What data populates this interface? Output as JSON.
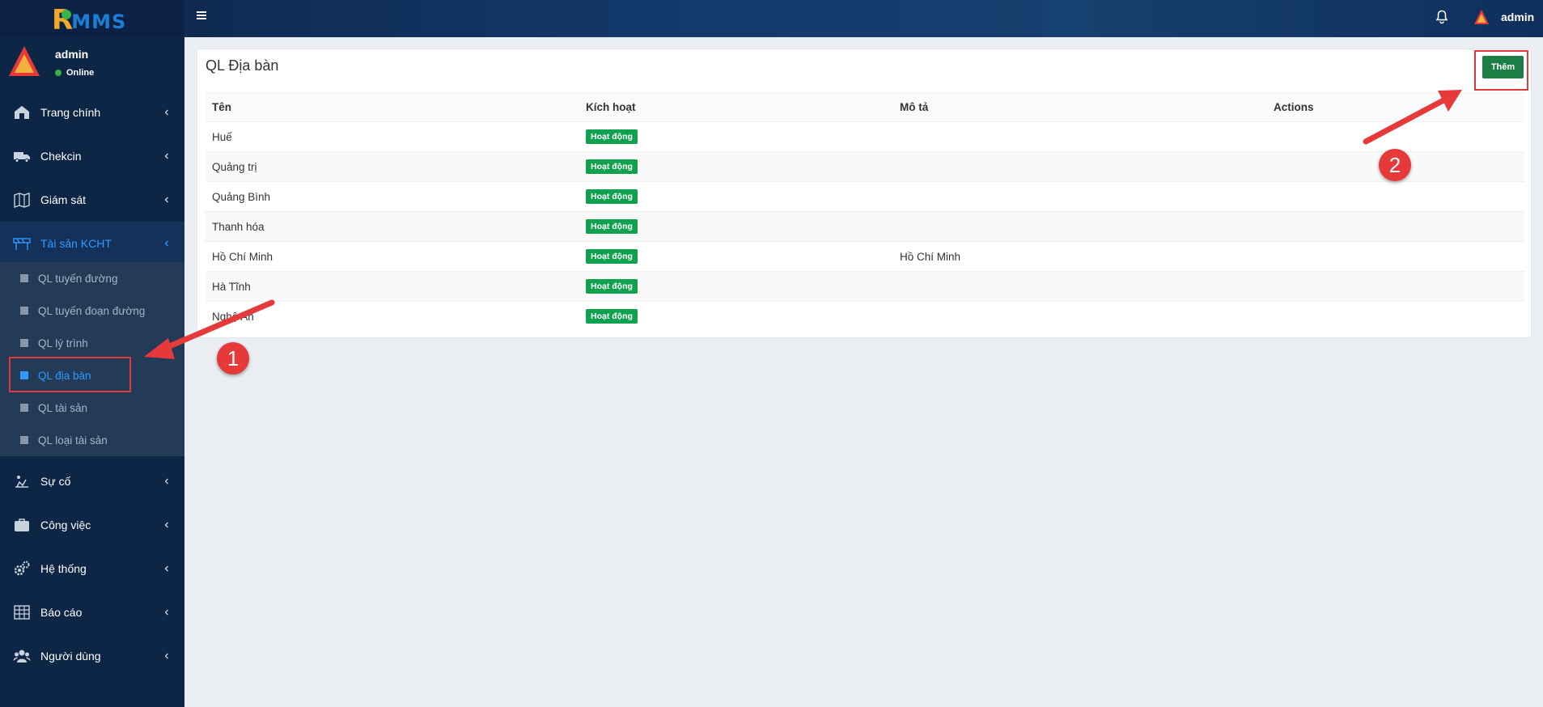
{
  "app": {
    "logo_r": "R",
    "logo_mms": "MMS",
    "top_user": "admin"
  },
  "user_panel": {
    "name": "admin",
    "status": "Online"
  },
  "sidebar": {
    "items": [
      {
        "label": "Trang chính",
        "icon": "home-icon"
      },
      {
        "label": "Chekcin",
        "icon": "truck-icon"
      },
      {
        "label": "Giám sát",
        "icon": "map-icon"
      },
      {
        "label": "Tài sản KCHT",
        "icon": "barrier-icon"
      },
      {
        "label": "Sự cố",
        "icon": "incident-icon"
      },
      {
        "label": "Công việc",
        "icon": "briefcase-icon"
      },
      {
        "label": "Hệ thống",
        "icon": "gears-icon"
      },
      {
        "label": "Báo cáo",
        "icon": "table-icon"
      },
      {
        "label": "Người dùng",
        "icon": "users-icon"
      }
    ],
    "submenu": [
      {
        "label": "QL tuyến đường"
      },
      {
        "label": "QL tuyến đoạn đường"
      },
      {
        "label": "QL lý trình"
      },
      {
        "label": "QL địa bàn"
      },
      {
        "label": "QL tài sản"
      },
      {
        "label": "QL loại tài sản"
      }
    ]
  },
  "main": {
    "title": "QL Địa bàn",
    "add_button": "Thêm",
    "columns": [
      "Tên",
      "Kích hoạt",
      "Mô tả",
      "Actions"
    ],
    "rows": [
      {
        "name": "Huế",
        "status": "Hoạt động",
        "desc": ""
      },
      {
        "name": "Quảng trị",
        "status": "Hoạt động",
        "desc": ""
      },
      {
        "name": "Quảng Bình",
        "status": "Hoạt động",
        "desc": ""
      },
      {
        "name": "Thanh hóa",
        "status": "Hoạt động",
        "desc": ""
      },
      {
        "name": "Hồ Chí Minh",
        "status": "Hoạt động",
        "desc": "Hồ Chí Minh"
      },
      {
        "name": "Hà Tĩnh",
        "status": "Hoạt động",
        "desc": ""
      },
      {
        "name": "Nghệ An",
        "status": "Hoạt động",
        "desc": ""
      }
    ]
  },
  "annotations": {
    "step1": "1",
    "step2": "2",
    "color": "#e63a3a"
  }
}
